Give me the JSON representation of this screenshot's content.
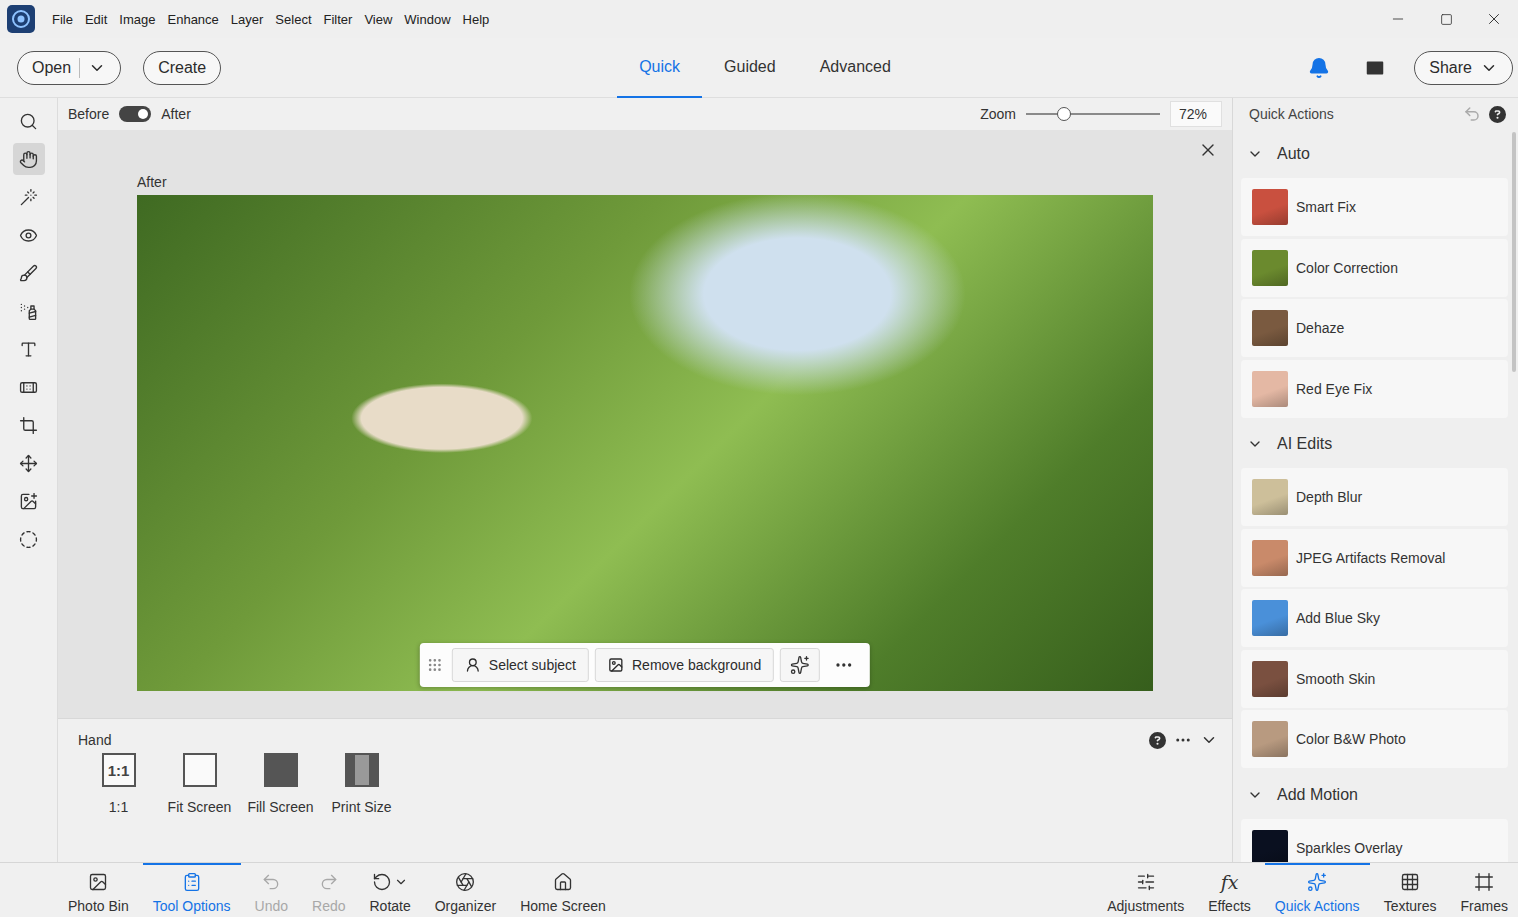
{
  "menu": [
    "File",
    "Edit",
    "Image",
    "Enhance",
    "Layer",
    "Select",
    "Filter",
    "View",
    "Window",
    "Help"
  ],
  "top_bar": {
    "open": "Open",
    "create": "Create",
    "modes": [
      {
        "label": "Quick",
        "selected": true
      },
      {
        "label": "Guided",
        "selected": false
      },
      {
        "label": "Advanced",
        "selected": false
      }
    ],
    "share": "Share"
  },
  "view_bar": {
    "before": "Before",
    "after": "After",
    "after_on": true,
    "zoom_label": "Zoom",
    "zoom_level": 0.28,
    "zoom_value": "72%"
  },
  "tools": [
    {
      "kind": "zoom",
      "selected": false
    },
    {
      "kind": "hand",
      "selected": true
    },
    {
      "kind": "quick-select",
      "selected": false
    },
    {
      "kind": "red-eye",
      "selected": false
    },
    {
      "kind": "brush",
      "selected": false
    },
    {
      "kind": "smart-brush",
      "selected": false
    },
    {
      "kind": "type",
      "selected": false
    },
    {
      "kind": "healing",
      "selected": false
    },
    {
      "kind": "crop",
      "selected": false
    },
    {
      "kind": "move",
      "selected": false
    },
    {
      "kind": "recompose",
      "selected": false
    },
    {
      "kind": "lasso",
      "selected": false
    }
  ],
  "canvas": {
    "label": "After",
    "buttons": [
      {
        "label": "Select subject",
        "kind": "select-subject"
      },
      {
        "label": "Remove background",
        "kind": "remove-background"
      }
    ]
  },
  "tool_options": {
    "title": "Hand",
    "options": [
      {
        "label": "1:1",
        "kind": "actual",
        "icon_text": "1:1"
      },
      {
        "label": "Fit Screen",
        "kind": "fit",
        "icon_text": ""
      },
      {
        "label": "Fill Screen",
        "kind": "fill",
        "icon_text": ""
      },
      {
        "label": "Print Size",
        "kind": "print",
        "icon_text": ""
      }
    ]
  },
  "bottom_bar": {
    "left": [
      {
        "label": "Photo Bin",
        "kind": "photo-bin",
        "selected": false,
        "disabled": false,
        "icon_text": ""
      },
      {
        "label": "Tool Options",
        "kind": "tool-options",
        "selected": true,
        "disabled": false,
        "icon_text": ""
      },
      {
        "label": "Undo",
        "kind": "undo",
        "selected": false,
        "disabled": true,
        "icon_text": ""
      },
      {
        "label": "Redo",
        "kind": "redo",
        "selected": false,
        "disabled": true,
        "icon_text": ""
      },
      {
        "label": "Rotate",
        "kind": "rotate",
        "selected": false,
        "disabled": false,
        "icon_text": ""
      },
      {
        "label": "Organizer",
        "kind": "organizer",
        "selected": false,
        "disabled": false,
        "icon_text": ""
      },
      {
        "label": "Home Screen",
        "kind": "home",
        "selected": false,
        "disabled": false,
        "icon_text": ""
      }
    ],
    "right": [
      {
        "label": "Adjustments",
        "kind": "adjustments",
        "selected": false,
        "disabled": false,
        "icon_text": ""
      },
      {
        "label": "Effects",
        "kind": "effects",
        "selected": false,
        "disabled": false,
        "icon_text": "fx"
      },
      {
        "label": "Quick Actions",
        "kind": "quick-actions",
        "selected": true,
        "disabled": false,
        "icon_text": ""
      },
      {
        "label": "Textures",
        "kind": "textures",
        "selected": false,
        "disabled": false,
        "icon_text": ""
      },
      {
        "label": "Frames",
        "kind": "frames",
        "selected": false,
        "disabled": false,
        "icon_text": ""
      }
    ]
  },
  "quick_actions": {
    "title": "Quick Actions",
    "sections": [
      {
        "title": "Auto",
        "expanded": true,
        "items": [
          {
            "label": "Smart Fix",
            "color": "#c9503f"
          },
          {
            "label": "Color Correction",
            "color": "#6b8a2e"
          },
          {
            "label": "Dehaze",
            "color": "#7a5a40"
          },
          {
            "label": "Red Eye Fix",
            "color": "#e4b8a4"
          }
        ]
      },
      {
        "title": "AI Edits",
        "expanded": true,
        "items": [
          {
            "label": "Depth Blur",
            "color": "#cdbf9a"
          },
          {
            "label": "JPEG Artifacts Removal",
            "color": "#c98a6a"
          },
          {
            "label": "Add Blue Sky",
            "color": "#4a90d9"
          },
          {
            "label": "Smooth Skin",
            "color": "#7a5040"
          },
          {
            "label": "Color B&W Photo",
            "color": "#b89a80"
          }
        ]
      },
      {
        "title": "Add Motion",
        "expanded": true,
        "items": [
          {
            "label": "Sparkles Overlay",
            "color": "#0a1020"
          }
        ]
      }
    ]
  }
}
